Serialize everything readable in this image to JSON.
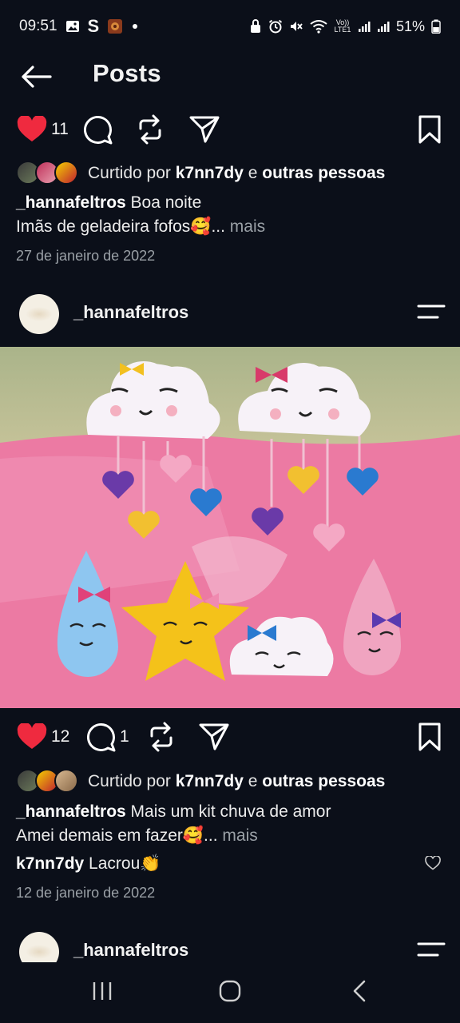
{
  "status_bar": {
    "time": "09:51",
    "battery": "51%",
    "left_icons": [
      "image-icon",
      "s-app-icon",
      "app-thumbnail-icon",
      "dot-icon"
    ],
    "right_icons": [
      "lock-icon",
      "alarm-icon",
      "mute-icon",
      "wifi-icon",
      "volte-icon",
      "signal-icon",
      "signal-icon",
      "battery-icon"
    ],
    "volte_label": "Vo)) LTE1"
  },
  "header": {
    "title": "Posts",
    "back_icon": "arrow-left-icon"
  },
  "post1": {
    "like_count": "11",
    "liked_prefix": "Curtido por ",
    "liked_user": "k7nn7dy",
    "liked_mid": " e ",
    "liked_others": "outras pessoas",
    "caption_user": "_hannafeltros",
    "caption_text": " Boa noite",
    "caption_line2": "Imãs de geladeira fofos🥰...",
    "more": " mais",
    "date": "27 de janeiro de 2022"
  },
  "post2": {
    "username": "_hannafeltros",
    "like_count": "12",
    "comment_count": "1",
    "liked_prefix": "Curtido por ",
    "liked_user": "k7nn7dy",
    "liked_mid": " e ",
    "liked_others": "outras pessoas",
    "caption_user": "_hannafeltros",
    "caption_text": " Mais um kit chuva de amor",
    "caption_line2": "Amei demais em fazer🥰...",
    "more": " mais",
    "comment_user": "k7nn7dy",
    "comment_text": " Lacrou👏",
    "date": "12 de janeiro de 2022"
  },
  "post3": {
    "username": "_hannafeltros"
  },
  "colors": {
    "background": "#0b0f19",
    "like_red": "#ef2a3f",
    "text": "#f2f2f2",
    "muted": "#9aa0a6"
  }
}
